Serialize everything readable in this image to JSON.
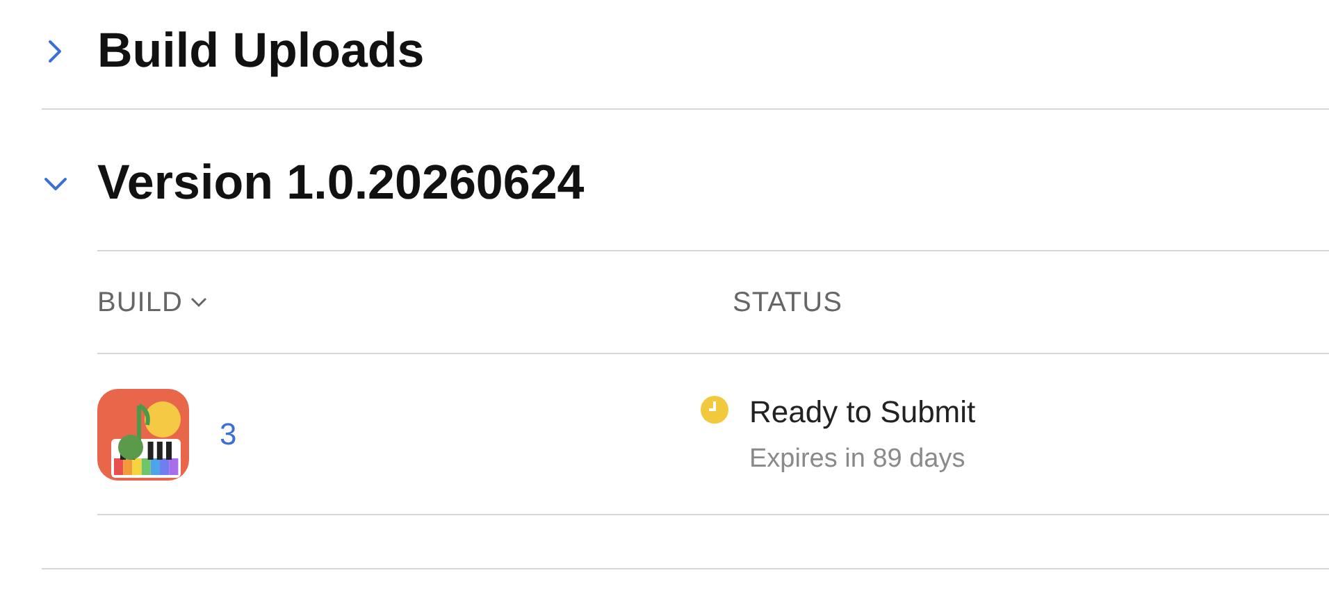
{
  "sections": [
    {
      "title": "Build Uploads",
      "expanded": false
    },
    {
      "title": "Version 1.0.20260624",
      "expanded": true,
      "table": {
        "columns": [
          {
            "label": "BUILD",
            "sortable": true
          },
          {
            "label": "STATUS",
            "sortable": false
          }
        ],
        "rows": [
          {
            "build": "3",
            "status": "Ready to Submit",
            "detail": "Expires in 89 days"
          }
        ]
      }
    }
  ]
}
